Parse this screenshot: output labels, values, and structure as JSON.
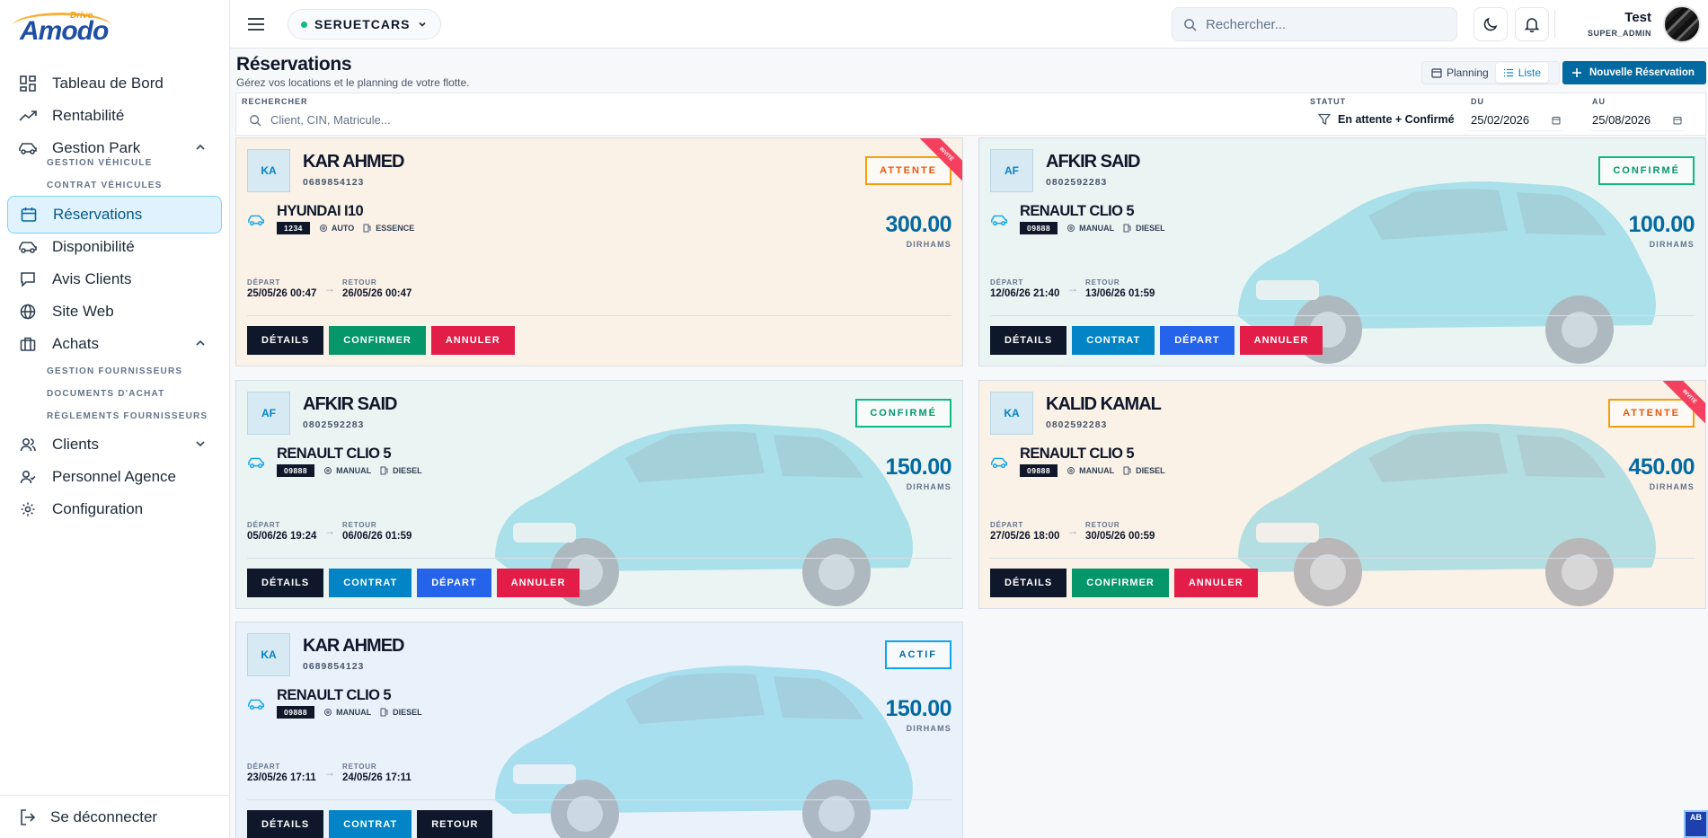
{
  "brand": {
    "top": "Drive",
    "name": "Amodo"
  },
  "sidebar": {
    "items": [
      {
        "label": "Tableau de Bord",
        "icon": "dashboard-icon"
      },
      {
        "label": "Rentabilité",
        "icon": "trending-up-icon"
      },
      {
        "label": "Gestion Park",
        "icon": "car-icon",
        "expanded": true
      },
      {
        "label": "Réservations",
        "icon": "calendar-icon",
        "active": true
      },
      {
        "label": "Disponibilité",
        "icon": "car-icon"
      },
      {
        "label": "Avis Clients",
        "icon": "message-icon"
      },
      {
        "label": "Site Web",
        "icon": "globe-icon"
      },
      {
        "label": "Achats",
        "icon": "briefcase-icon",
        "expanded": true
      },
      {
        "label": "Clients",
        "icon": "users-icon",
        "expanded": false
      },
      {
        "label": "Personnel Agence",
        "icon": "user-group-icon"
      },
      {
        "label": "Configuration",
        "icon": "gear-icon"
      }
    ],
    "park_sub": [
      "GESTION VÉHICULE",
      "CONTRAT VÉHICULES"
    ],
    "achats_sub": [
      "GESTION FOURNISSEURS",
      "DOCUMENTS D'ACHAT",
      "RÈGLEMENTS FOURNISSEURS"
    ],
    "logout": "Se déconnecter"
  },
  "topbar": {
    "agency": "SERUETCARS",
    "search_placeholder": "Rechercher...",
    "user_name": "Test",
    "user_role": "SUPER_ADMIN"
  },
  "header": {
    "title": "Réservations",
    "subtitle": "Gérez vos locations et le planning de votre flotte.",
    "view_planning": "Planning",
    "view_list": "Liste",
    "new_button": "Nouvelle Réservation"
  },
  "filters": {
    "search_label": "RECHERCHER",
    "search_placeholder": "Client, CIN, Matricule...",
    "status_label": "STATUT",
    "status_value": "En attente + Confirmé",
    "from_label": "DU",
    "from_value": "25/02/2026",
    "to_label": "AU",
    "to_value": "25/08/2026"
  },
  "labels": {
    "currency": "DIRHAMS",
    "depart": "DÉPART",
    "retour": "RETOUR",
    "ribbon": "INVITÉ"
  },
  "cards": [
    {
      "initials": "KA",
      "name": "KAR AHMED",
      "phone": "0689854123",
      "status": "ATTENTE",
      "status_kind": "attente",
      "ribbon": true,
      "model": "HYUNDAI I10",
      "plate": "1234",
      "gearbox": "AUTO",
      "fuel": "ESSENCE",
      "price": "300.00",
      "depart": "25/05/26 00:47",
      "retour": "26/05/26 00:47",
      "actions": [
        "DÉTAILS",
        "CONFIRMER",
        "ANNULER"
      ]
    },
    {
      "initials": "AF",
      "name": "AFKIR SAID",
      "phone": "0802592283",
      "status": "CONFIRMÉ",
      "status_kind": "confirme",
      "ribbon": false,
      "model": "RENAULT CLIO 5",
      "plate": "09888",
      "gearbox": "MANUAL",
      "fuel": "DIESEL",
      "price": "100.00",
      "depart": "12/06/26 21:40",
      "retour": "13/06/26 01:59",
      "actions": [
        "DÉTAILS",
        "CONTRAT",
        "DÉPART",
        "ANNULER"
      ]
    },
    {
      "initials": "AF",
      "name": "AFKIR SAID",
      "phone": "0802592283",
      "status": "CONFIRMÉ",
      "status_kind": "confirme",
      "ribbon": false,
      "model": "RENAULT CLIO 5",
      "plate": "09888",
      "gearbox": "MANUAL",
      "fuel": "DIESEL",
      "price": "150.00",
      "depart": "05/06/26 19:24",
      "retour": "06/06/26 01:59",
      "actions": [
        "DÉTAILS",
        "CONTRAT",
        "DÉPART",
        "ANNULER"
      ]
    },
    {
      "initials": "KA",
      "name": "KALID KAMAL",
      "phone": "0802592283",
      "status": "ATTENTE",
      "status_kind": "attente",
      "ribbon": true,
      "model": "RENAULT CLIO 5",
      "plate": "09888",
      "gearbox": "MANUAL",
      "fuel": "DIESEL",
      "price": "450.00",
      "depart": "27/05/26 18:00",
      "retour": "30/05/26 00:59",
      "actions": [
        "DÉTAILS",
        "CONFIRMER",
        "ANNULER"
      ]
    },
    {
      "initials": "KA",
      "name": "KAR AHMED",
      "phone": "0689854123",
      "status": "ACTIF",
      "status_kind": "actif",
      "ribbon": false,
      "model": "RENAULT CLIO 5",
      "plate": "09888",
      "gearbox": "MANUAL",
      "fuel": "DIESEL",
      "price": "150.00",
      "depart": "23/05/26 17:11",
      "retour": "24/05/26 17:11",
      "actions": [
        "DÉTAILS",
        "CONTRAT",
        "RETOUR"
      ]
    }
  ],
  "corner_badge": "AB"
}
